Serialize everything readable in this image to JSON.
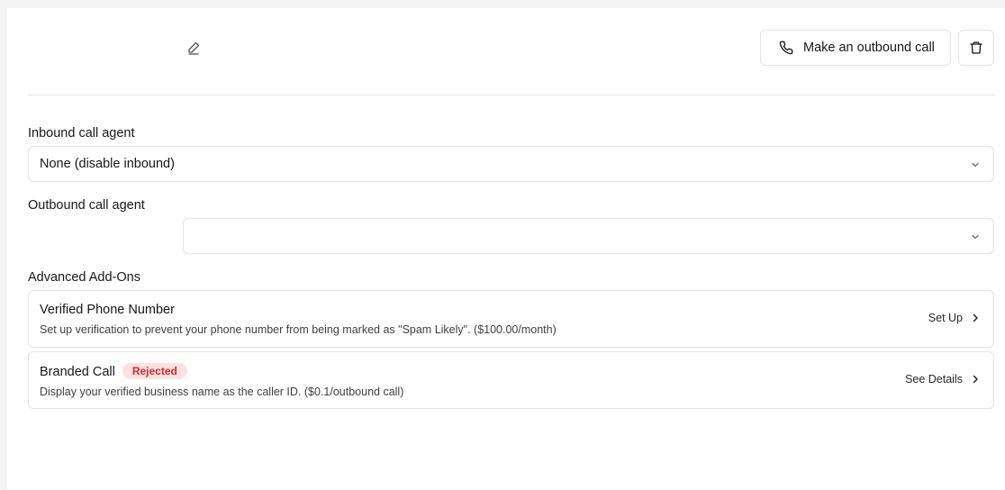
{
  "header": {
    "title": "",
    "call_button_label": "Make an outbound call"
  },
  "inbound": {
    "label": "Inbound call agent",
    "selected": "None (disable inbound)"
  },
  "outbound": {
    "label": "Outbound call agent",
    "selected": ""
  },
  "addons": {
    "label": "Advanced Add-Ons",
    "items": [
      {
        "title": "Verified Phone Number",
        "description": "Set up verification to prevent your phone number from being marked as \"Spam Likely\". ($100.00/month)",
        "action": "Set Up"
      },
      {
        "title": "Branded Call",
        "badge": "Rejected",
        "description": "Display your verified business name as the caller ID. ($0.1/outbound call)",
        "action": "See Details"
      }
    ]
  },
  "colors": {
    "badge_bg": "#fee2e2",
    "badge_text": "#dc2626",
    "border": "#e4e4e7"
  }
}
